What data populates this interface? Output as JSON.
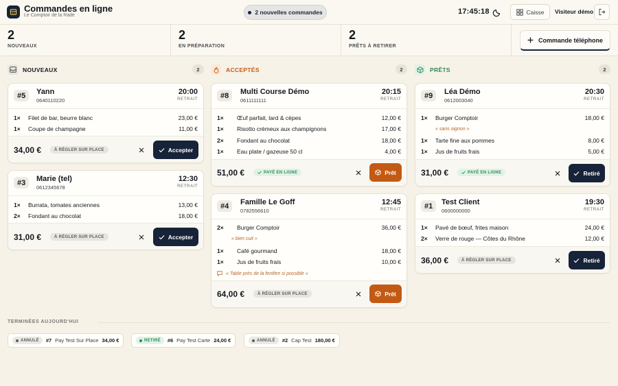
{
  "header": {
    "title": "Commandes en ligne",
    "subtitle": "Le Comptoir de la Rade",
    "new_orders_pill": "2 nouvelles commandes",
    "clock": "17:45:18",
    "caisse_label": "Caisse",
    "visitor_label": "Visiteur démo"
  },
  "stats": [
    {
      "value": "2",
      "label": "NOUVEAUX"
    },
    {
      "value": "2",
      "label": "EN PRÉPARATION"
    },
    {
      "value": "2",
      "label": "PRÊTS À RETIRER"
    }
  ],
  "phone_order_button": "Commande téléphone",
  "colors": {
    "navy": "#162338",
    "orange": "#c35a14",
    "green": "#2e8b55",
    "background": "#f6f2e8"
  },
  "columns": [
    {
      "title": "NOUVEAUX",
      "count": "2",
      "icon": "inbox-icon"
    },
    {
      "title": "ACCEPTÉS",
      "count": "2",
      "icon": "flame-icon"
    },
    {
      "title": "PRÊTS",
      "count": "2",
      "icon": "package-icon"
    }
  ],
  "cards": {
    "c5": {
      "number": "#5",
      "name": "Yann",
      "phone": "0640110220",
      "time": "20:00",
      "mode": "RETRAIT",
      "items": [
        {
          "qty": "1×",
          "name": "Filet de bar, beurre blanc",
          "price": "23,00 €"
        },
        {
          "qty": "1×",
          "name": "Coupe de champagne",
          "price": "11,00 €"
        }
      ],
      "total": "34,00 €",
      "payment": "À RÉGLER SUR PLACE",
      "action": "Accepter"
    },
    "c3": {
      "number": "#3",
      "name": "Marie (tel)",
      "phone": "0612345678",
      "time": "12:30",
      "mode": "RETRAIT",
      "items": [
        {
          "qty": "1×",
          "name": "Burrata, tomates anciennes",
          "price": "13,00 €"
        },
        {
          "qty": "2×",
          "name": "Fondant au chocolat",
          "price": "18,00 €"
        }
      ],
      "total": "31,00 €",
      "payment": "À RÉGLER SUR PLACE",
      "action": "Accepter"
    },
    "c8": {
      "number": "#8",
      "name": "Multi Course Démo",
      "phone": "0611111111",
      "time": "20:15",
      "mode": "RETRAIT",
      "items": [
        {
          "qty": "1×",
          "name": "Œuf parfait, lard & cèpes",
          "price": "12,00 €"
        },
        {
          "qty": "1×",
          "name": "Risotto crémeux aux champignons",
          "price": "17,00 €"
        },
        {
          "qty": "2×",
          "name": "Fondant au chocolat",
          "price": "18,00 €"
        },
        {
          "qty": "1×",
          "name": "Eau plate / gazeuse 50 cl",
          "price": "4,00 €"
        }
      ],
      "total": "51,00 €",
      "payment": "PAYÉ EN LIGNE",
      "action": "Prêt"
    },
    "c4": {
      "number": "#4",
      "name": "Famille Le Goff",
      "phone": "0782556610",
      "time": "12:45",
      "mode": "RETRAIT",
      "items": [
        {
          "qty": "2×",
          "name": "Burger Comptoir",
          "price": "36,00 €",
          "note": "« bien cuit »"
        },
        {
          "qty": "1×",
          "name": "Café gourmand",
          "price": "18,00 €"
        },
        {
          "qty": "1×",
          "name": "Jus de fruits frais",
          "price": "10,00 €"
        }
      ],
      "comment": "« Table près de la fenêtre si possible »",
      "total": "64,00 €",
      "payment": "À RÉGLER SUR PLACE",
      "action": "Prêt"
    },
    "c9": {
      "number": "#9",
      "name": "Léa Démo",
      "phone": "0612003040",
      "time": "20:30",
      "mode": "RETRAIT",
      "items": [
        {
          "qty": "1×",
          "name": "Burger Comptoir",
          "price": "18,00 €",
          "note": "« sans oignon »"
        },
        {
          "qty": "1×",
          "name": "Tarte fine aux pommes",
          "price": "8,00 €"
        },
        {
          "qty": "1×",
          "name": "Jus de fruits frais",
          "price": "5,00 €"
        }
      ],
      "total": "31,00 €",
      "payment": "PAYÉ EN LIGNE",
      "action": "Retiré"
    },
    "c1": {
      "number": "#1",
      "name": "Test Client",
      "phone": "0600000000",
      "time": "19:30",
      "mode": "RETRAIT",
      "items": [
        {
          "qty": "1×",
          "name": "Pavé de bœuf, frites maison",
          "price": "24,00 €"
        },
        {
          "qty": "2×",
          "name": "Verre de rouge — Côtes du Rhône",
          "price": "12,00 €"
        }
      ],
      "total": "36,00 €",
      "payment": "À RÉGLER SUR PLACE",
      "action": "Retiré"
    }
  },
  "completed": {
    "title": "TERMINÉES AUJOURD'HUI",
    "items": [
      {
        "status": "ANNULÉ",
        "number": "#7",
        "name": "Pay Test Sur Place",
        "amount": "34,00 €"
      },
      {
        "status": "RETIRÉ",
        "number": "#6",
        "name": "Pay Test Carte",
        "amount": "24,00 €"
      },
      {
        "status": "ANNULÉ",
        "number": "#2",
        "name": "Cap Test",
        "amount": "180,00 €"
      }
    ]
  }
}
